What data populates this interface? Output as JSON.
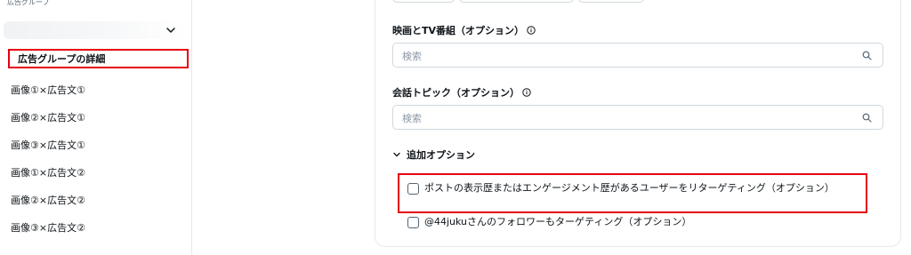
{
  "sidebar": {
    "header": "広告グループ",
    "group_chevron": "chevron-down-icon",
    "items": [
      {
        "label": "広告グループの詳細",
        "active": true
      },
      {
        "label": "画像①×広告文①"
      },
      {
        "label": "画像②×広告文①"
      },
      {
        "label": "画像③×広告文①"
      },
      {
        "label": "画像①×広告文②"
      },
      {
        "label": "画像②×広告文②"
      },
      {
        "label": "画像③×広告文②"
      }
    ]
  },
  "main": {
    "movies": {
      "label": "映画とTV番組（オプション）",
      "placeholder": "検索",
      "icon": "search-icon"
    },
    "topics": {
      "label": "会話トピック（オプション）",
      "placeholder": "検索",
      "icon": "search-icon"
    },
    "advanced": {
      "label": "追加オプション",
      "icon": "chevron-down-icon"
    },
    "options": [
      {
        "label": "ポストの表示歴またはエンゲージメント歴があるユーザーをリターゲティング（オプション）",
        "checked": false
      },
      {
        "label": "@44jukuさんのフォロワーもターゲティング（オプション）",
        "checked": false
      }
    ]
  },
  "colors": {
    "highlight": "#e60012",
    "border": "#cfd9de",
    "muted": "#536471"
  }
}
